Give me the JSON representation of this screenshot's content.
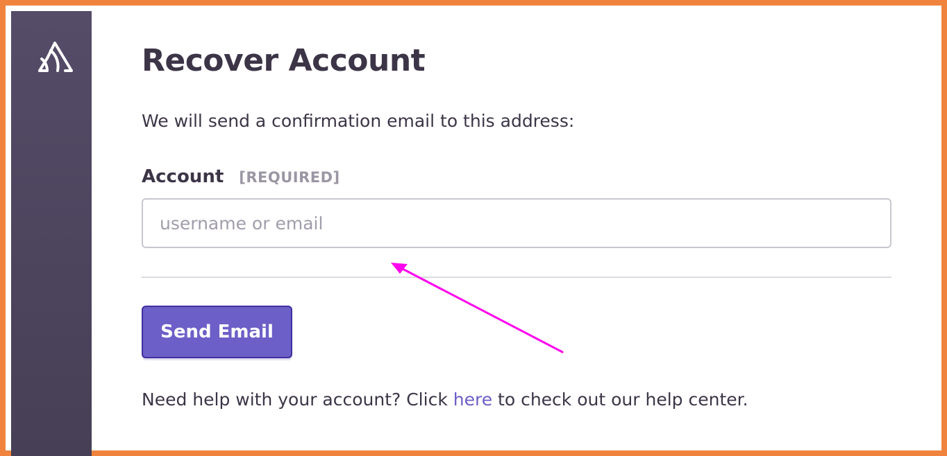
{
  "page": {
    "title": "Recover Account",
    "intro": "We will send a confirmation email to this address:"
  },
  "form": {
    "account_label": "Account",
    "required_tag": "[REQUIRED]",
    "account_placeholder": "username or email",
    "account_value": "",
    "submit_label": "Send Email"
  },
  "help": {
    "prefix": "Need help with your account? Click ",
    "link_text": "here",
    "suffix": " to check out our help center."
  },
  "icons": {
    "logo": "sentry-logo-icon",
    "annotation": "arrow-annotation"
  },
  "colors": {
    "frame_border": "#f0843f",
    "sidebar": "#4f4763",
    "accent": "#6c5fc7",
    "annotation_arrow": "#ff00ee",
    "text": "#3c3547"
  }
}
